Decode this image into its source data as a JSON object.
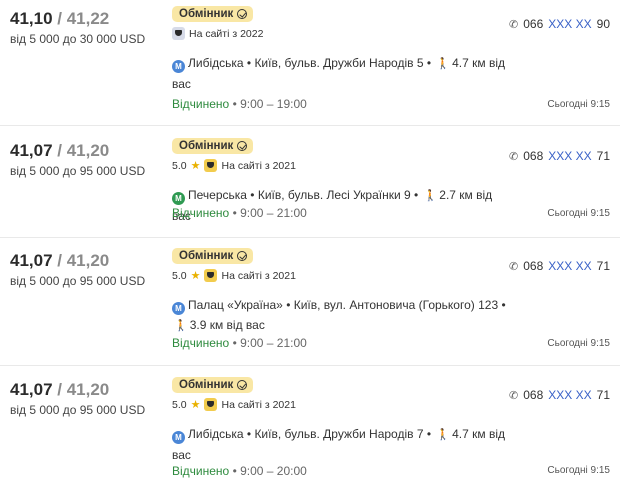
{
  "offers": [
    {
      "buy": "41,10",
      "sell": "41,22",
      "range": "від 5 000 до 30 000 USD",
      "badge": "Обмінник",
      "rating": "",
      "since": "На сайті з 2022",
      "metro": "Либідська",
      "metro_line": "blue",
      "address": "• Київ, бульв. Дружби Народів 5 •",
      "distance": "4.7 км від вас",
      "status": "Відчинено",
      "hours": "• 9:00 – 19:00",
      "phone_prefix": "066",
      "phone_mask": "XXX XX",
      "phone_suffix": "90",
      "updated": "Сьогодні 9:15"
    },
    {
      "buy": "41,07",
      "sell": "41,20",
      "range": "від 5 000 до 95 000 USD",
      "badge": "Обмінник",
      "rating": "5.0",
      "since": "На сайті з 2021",
      "metro": "Печерська",
      "metro_line": "green",
      "address": "• Київ, бульв. Лесі Українки 9 •",
      "distance": "2.7 км від вас",
      "status": "Відчинено",
      "hours": "• 9:00 – 21:00",
      "phone_prefix": "068",
      "phone_mask": "XXX XX",
      "phone_suffix": "71",
      "updated": "Сьогодні 9:15"
    },
    {
      "buy": "41,07",
      "sell": "41,20",
      "range": "від 5 000 до 95 000 USD",
      "badge": "Обмінник",
      "rating": "5.0",
      "since": "На сайті з 2021",
      "metro": "Палац «Україна»",
      "metro_line": "blue",
      "address": "• Київ, вул. Антоновича (Горького) 123 •",
      "distance": "3.9 км від вас",
      "status": "Відчинено",
      "hours": "• 9:00 – 21:00",
      "phone_prefix": "068",
      "phone_mask": "XXX XX",
      "phone_suffix": "71",
      "updated": "Сьогодні 9:15"
    },
    {
      "buy": "41,07",
      "sell": "41,20",
      "range": "від 5 000 до 95 000 USD",
      "badge": "Обмінник",
      "rating": "5.0",
      "since": "На сайті з 2021",
      "metro": "Либідська",
      "metro_line": "blue",
      "address": "• Київ, бульв. Дружби Народів 7 •",
      "distance": "4.7 км від вас",
      "status": "Відчинено",
      "hours": "• 9:00 – 20:00",
      "phone_prefix": "068",
      "phone_mask": "XXX XX",
      "phone_suffix": "71",
      "updated": "Сьогодні 9:15"
    }
  ],
  "colors": {
    "badge_bg": "#f9e7a5",
    "open_green": "#2e8b3e",
    "phone_mask_blue": "#3961c7",
    "metro_blue": "#4a86d6",
    "metro_green": "#2f9a52",
    "star": "#e9b100"
  }
}
